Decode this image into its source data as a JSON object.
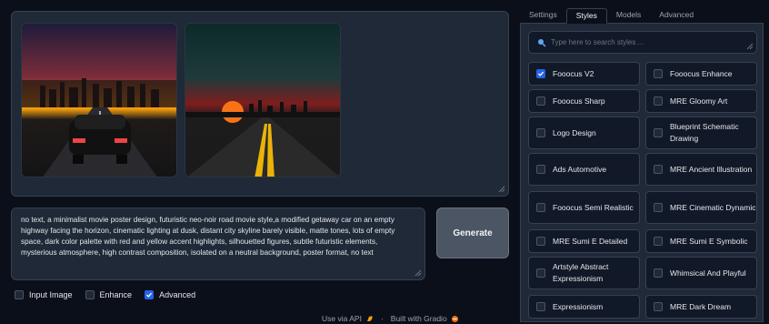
{
  "prompt": {
    "value": "no text, a minimalist movie poster design, futuristic neo-noir road movie style,a modified getaway car on an empty highway facing the horizon, cinematic lighting at dusk, distant city skyline barely visible, matte tones, lots of empty space, dark color palette with red and yellow accent highlights, silhouetted figures, subtle futuristic elements, mysterious atmosphere, high contrast composition, isolated on a neutral background, poster format, no text"
  },
  "generate_label": "Generate",
  "checkboxes": {
    "input_image": {
      "label": "Input Image",
      "checked": false
    },
    "enhance": {
      "label": "Enhance",
      "checked": false
    },
    "advanced": {
      "label": "Advanced",
      "checked": true
    }
  },
  "footer": {
    "api": "Use via API",
    "sep": "·",
    "built": "Built with Gradio"
  },
  "tabs": [
    "Settings",
    "Styles",
    "Models",
    "Advanced"
  ],
  "active_tab": "Styles",
  "search": {
    "placeholder": "Type here to search styles ..."
  },
  "styles": [
    {
      "label": "Fooocus V2",
      "checked": true
    },
    {
      "label": "Fooocus Enhance",
      "checked": false
    },
    {
      "label": "Fooocus Sharp",
      "checked": false
    },
    {
      "label": "MRE Gloomy Art",
      "checked": false
    },
    {
      "label": "Logo Design",
      "checked": false
    },
    {
      "label": "Blueprint Schematic Drawing",
      "checked": false
    },
    {
      "label": "Ads Automotive",
      "checked": false
    },
    {
      "label": "MRE Ancient Illustration",
      "checked": false
    },
    {
      "label": "Fooocus Semi Realistic",
      "checked": false
    },
    {
      "label": "MRE Cinematic Dynamic",
      "checked": false
    },
    {
      "label": "MRE Sumi E Detailed",
      "checked": false
    },
    {
      "label": "MRE Sumi E Symbolic",
      "checked": false
    },
    {
      "label": "Artstyle Abstract Expressionism",
      "checked": false
    },
    {
      "label": "Whimsical And Playful",
      "checked": false
    },
    {
      "label": "Expressionism",
      "checked": false
    },
    {
      "label": "MRE Dark Dream",
      "checked": false
    }
  ],
  "colors": {
    "accent": "#2563eb",
    "background": "#0b0f19",
    "panel": "#1f2937",
    "border": "#374151"
  }
}
